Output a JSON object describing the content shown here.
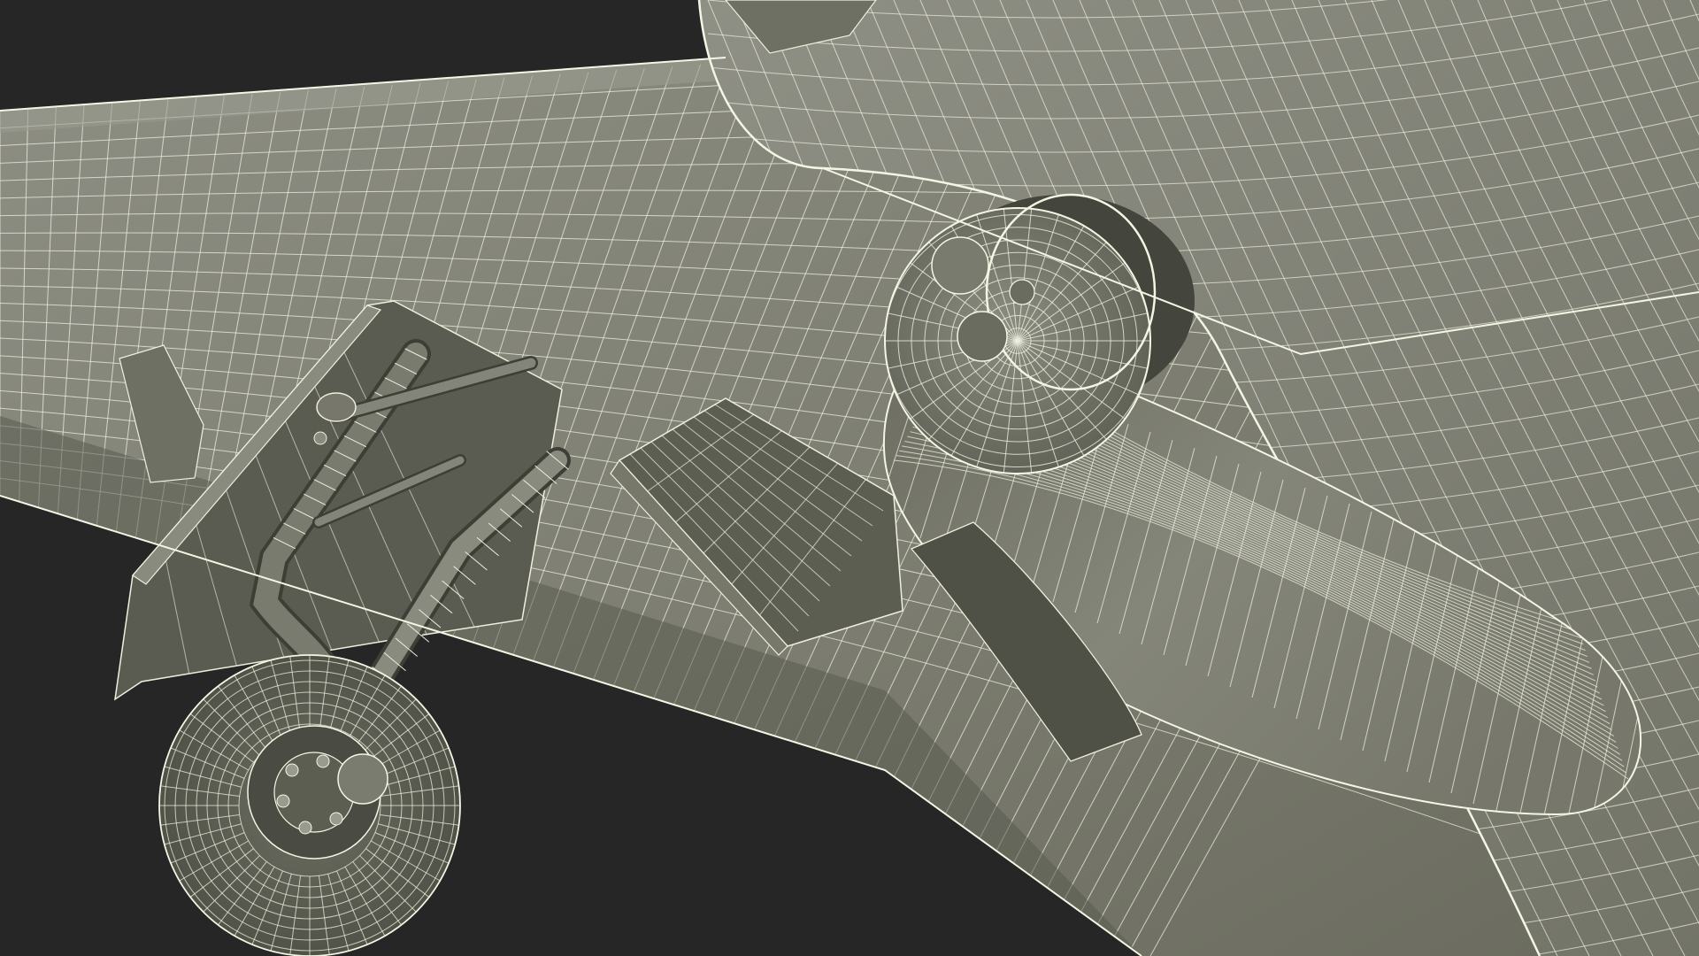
{
  "scene": {
    "subject": "aircraft-underside-wireframe-render",
    "colors": {
      "background": "#262626",
      "surface_light": "#8d8e82",
      "surface_mid": "#777869",
      "surface_dark": "#55564b",
      "shadow": "#3f4038",
      "wire": "#eef0dd"
    },
    "icons": {
      "wheel": "landing-gear-wheel-icon",
      "fairing": "wing-fairing-icon",
      "dome": "sensor-dome-icon"
    }
  }
}
